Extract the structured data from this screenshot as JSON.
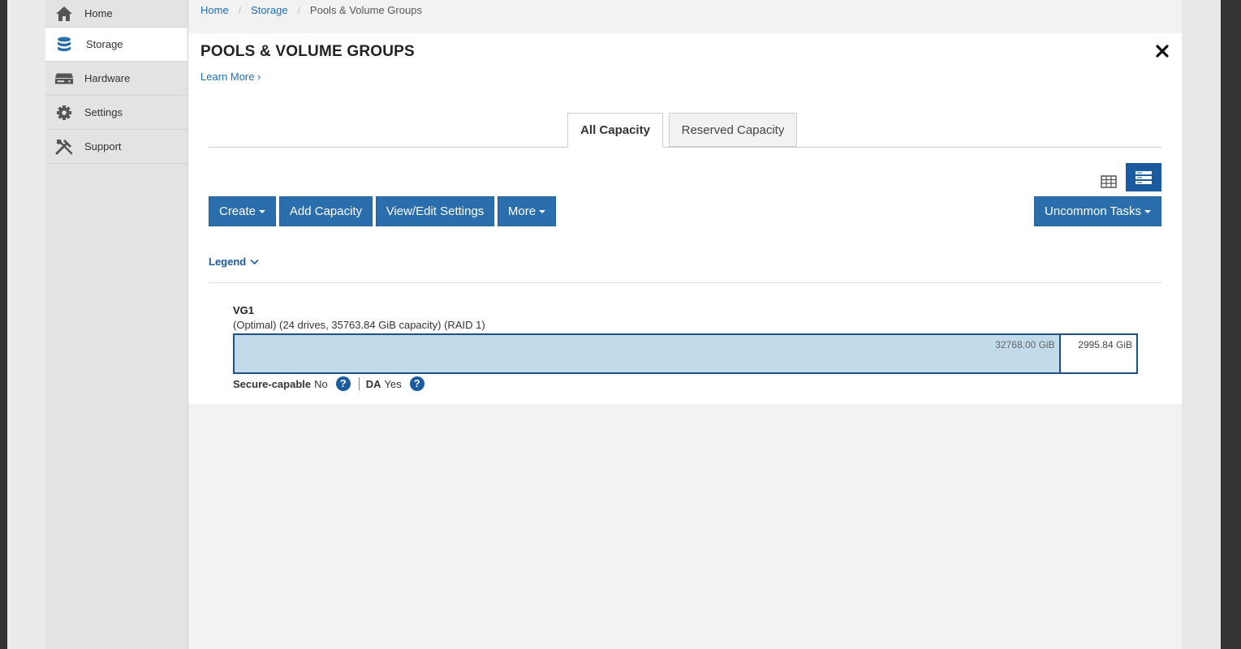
{
  "sidebar": {
    "items": [
      {
        "label": "Home",
        "icon": "home-icon"
      },
      {
        "label": "Storage",
        "icon": "database-icon"
      },
      {
        "label": "Hardware",
        "icon": "hardware-icon"
      },
      {
        "label": "Settings",
        "icon": "gear-icon"
      },
      {
        "label": "Support",
        "icon": "tools-icon"
      }
    ],
    "active": "Storage"
  },
  "breadcrumb": {
    "items": [
      "Home",
      "Storage",
      "Pools & Volume Groups"
    ],
    "separator": "/"
  },
  "page": {
    "title": "POOLS & VOLUME GROUPS",
    "learn_more": "Learn More ›"
  },
  "tabs": [
    {
      "label": "All Capacity",
      "active": true
    },
    {
      "label": "Reserved Capacity",
      "active": false
    }
  ],
  "toolbar": {
    "create": "Create",
    "add_capacity": "Add Capacity",
    "view_edit_settings": "View/Edit Settings",
    "more": "More",
    "uncommon_tasks": "Uncommon Tasks"
  },
  "legend": {
    "label": "Legend"
  },
  "volume_group": {
    "name": "VG1",
    "description": "(Optimal) (24 drives, 35763.84 GiB capacity) (RAID 1)",
    "used_label": "32768.00 GiB",
    "free_label": "2995.84 GiB",
    "used_fraction": 0.916,
    "secure_capable_key": "Secure-capable",
    "secure_capable_value": "No",
    "da_key": "DA",
    "da_value": "Yes",
    "help_glyph": "?"
  },
  "colors": {
    "accent": "#2a6ead",
    "used_fill": "#c1dbeb",
    "bar_border": "#1f4f85",
    "link": "#1e6eb4"
  }
}
